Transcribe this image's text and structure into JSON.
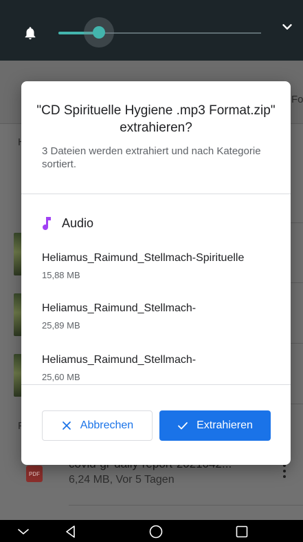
{
  "status_bar": {
    "icons": [
      "bell-icon",
      "chevron-down-icon"
    ],
    "volume_level": 0.2
  },
  "background": {
    "header_edge_text": "Fo",
    "section_letter_1": "H",
    "section_letter_2": "F",
    "recent_file": {
      "badge": "PDF",
      "name": "covid-gr-daily-report-2021042...",
      "meta": "6,24 MB, Vor 5 Tagen"
    }
  },
  "dialog": {
    "title": "\"CD Spirituelle Hygiene .mp3 Format.zip\" extrahieren?",
    "description": "3 Dateien werden extrahiert und nach Kategorie sortiert.",
    "category": {
      "label": "Audio",
      "icon": "music-note-icon",
      "color": "#a142f4"
    },
    "files": [
      {
        "name": "Heliamus_Raimund_Stellmach-Spirituelle",
        "size": "15,88 MB"
      },
      {
        "name": "Heliamus_Raimund_Stellmach-",
        "size": "25,89 MB"
      },
      {
        "name": "Heliamus_Raimund_Stellmach-",
        "size": "25,60 MB"
      }
    ],
    "cancel_label": "Abbrechen",
    "extract_label": "Extrahieren",
    "accent_color": "#1a73e8"
  },
  "nav_bar": {
    "icons": [
      "collapse-icon",
      "back-icon",
      "home-icon",
      "recents-icon"
    ]
  }
}
